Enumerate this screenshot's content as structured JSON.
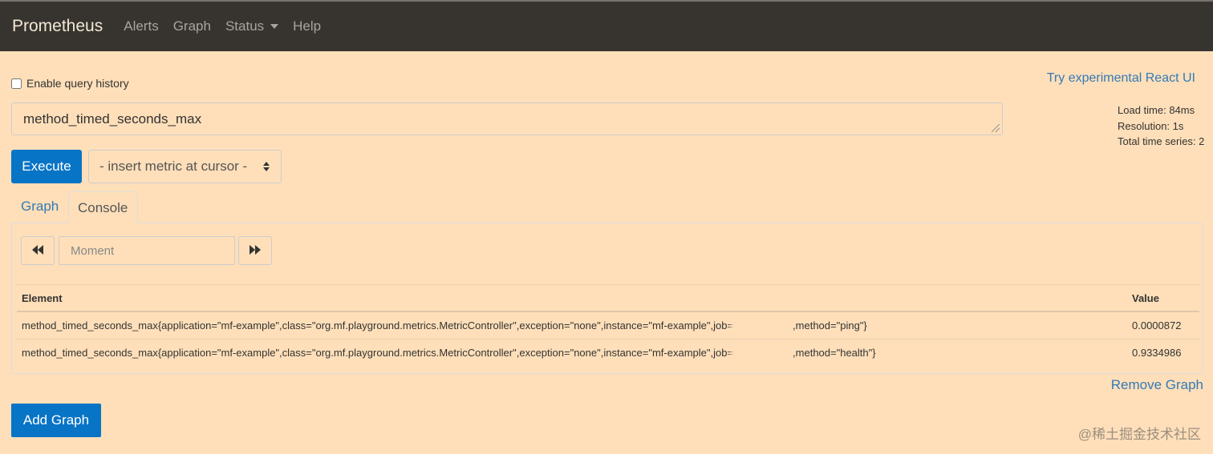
{
  "navbar": {
    "brand": "Prometheus",
    "links": [
      "Alerts",
      "Graph",
      "Status",
      "Help"
    ]
  },
  "query_history": {
    "label": "Enable query history",
    "checked": false
  },
  "react_link": "Try experimental React UI",
  "query": {
    "value": "method_timed_seconds_max"
  },
  "stats": {
    "load_time": "Load time: 84ms",
    "resolution": "Resolution: 1s",
    "total_series": "Total time series: 2"
  },
  "execute_label": "Execute",
  "metric_select": "- insert metric at cursor -",
  "tabs": {
    "graph": "Graph",
    "console": "Console"
  },
  "moment": {
    "placeholder": "Moment"
  },
  "table": {
    "headers": [
      "Element",
      "Value"
    ],
    "rows": [
      {
        "element_prefix": "method_timed_seconds_max{application=\"mf-example\",class=\"org.mf.playground.metrics.MetricController\",exception=\"none\",instance=\"mf-example\",job=",
        "element_suffix": ",method=\"ping\"}",
        "value": "0.0000872"
      },
      {
        "element_prefix": "method_timed_seconds_max{application=\"mf-example\",class=\"org.mf.playground.metrics.MetricController\",exception=\"none\",instance=\"mf-example\",job=",
        "element_suffix": ",method=\"health\"}",
        "value": "0.9334986"
      }
    ]
  },
  "remove_graph": "Remove Graph",
  "add_graph": "Add Graph",
  "watermark": "@稀土掘金技术社区",
  "colors": {
    "background": "#ffdfb9",
    "navbar": "#373430",
    "primary": "#0874c6",
    "link": "#337ab7"
  }
}
